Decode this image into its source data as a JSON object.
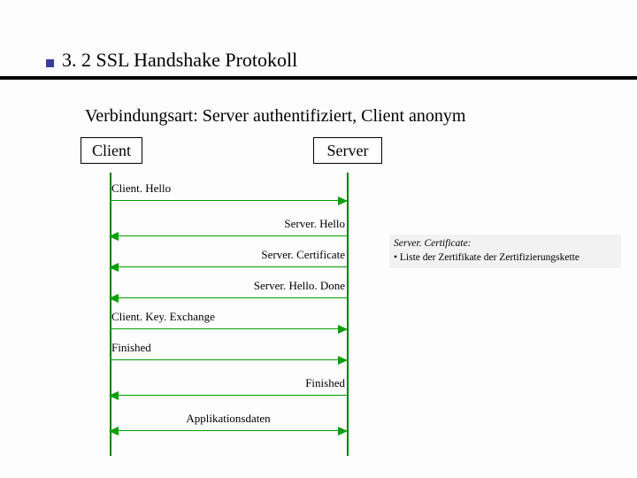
{
  "title": "3. 2 SSL Handshake Protokoll",
  "subtitle": "Verbindungsart: Server authentifiziert, Client anonym",
  "participants": {
    "client": "Client",
    "server": "Server"
  },
  "messages": {
    "client_hello": "Client. Hello",
    "server_hello": "Server. Hello",
    "server_certificate": "Server. Certificate",
    "server_hello_done": "Server. Hello. Done",
    "client_key_exchange": "Client. Key. Exchange",
    "finished_c": "Finished",
    "finished_s": "Finished",
    "app_data": "Applikationsdaten"
  },
  "note": {
    "heading": "Server. Certificate:",
    "line1": "• Liste der Zertifikate der Zertifizierungskette"
  },
  "colors": {
    "accent_square": "#3c3c9c",
    "arrow": "#00a000",
    "note_bg": "#f2f2f2"
  }
}
